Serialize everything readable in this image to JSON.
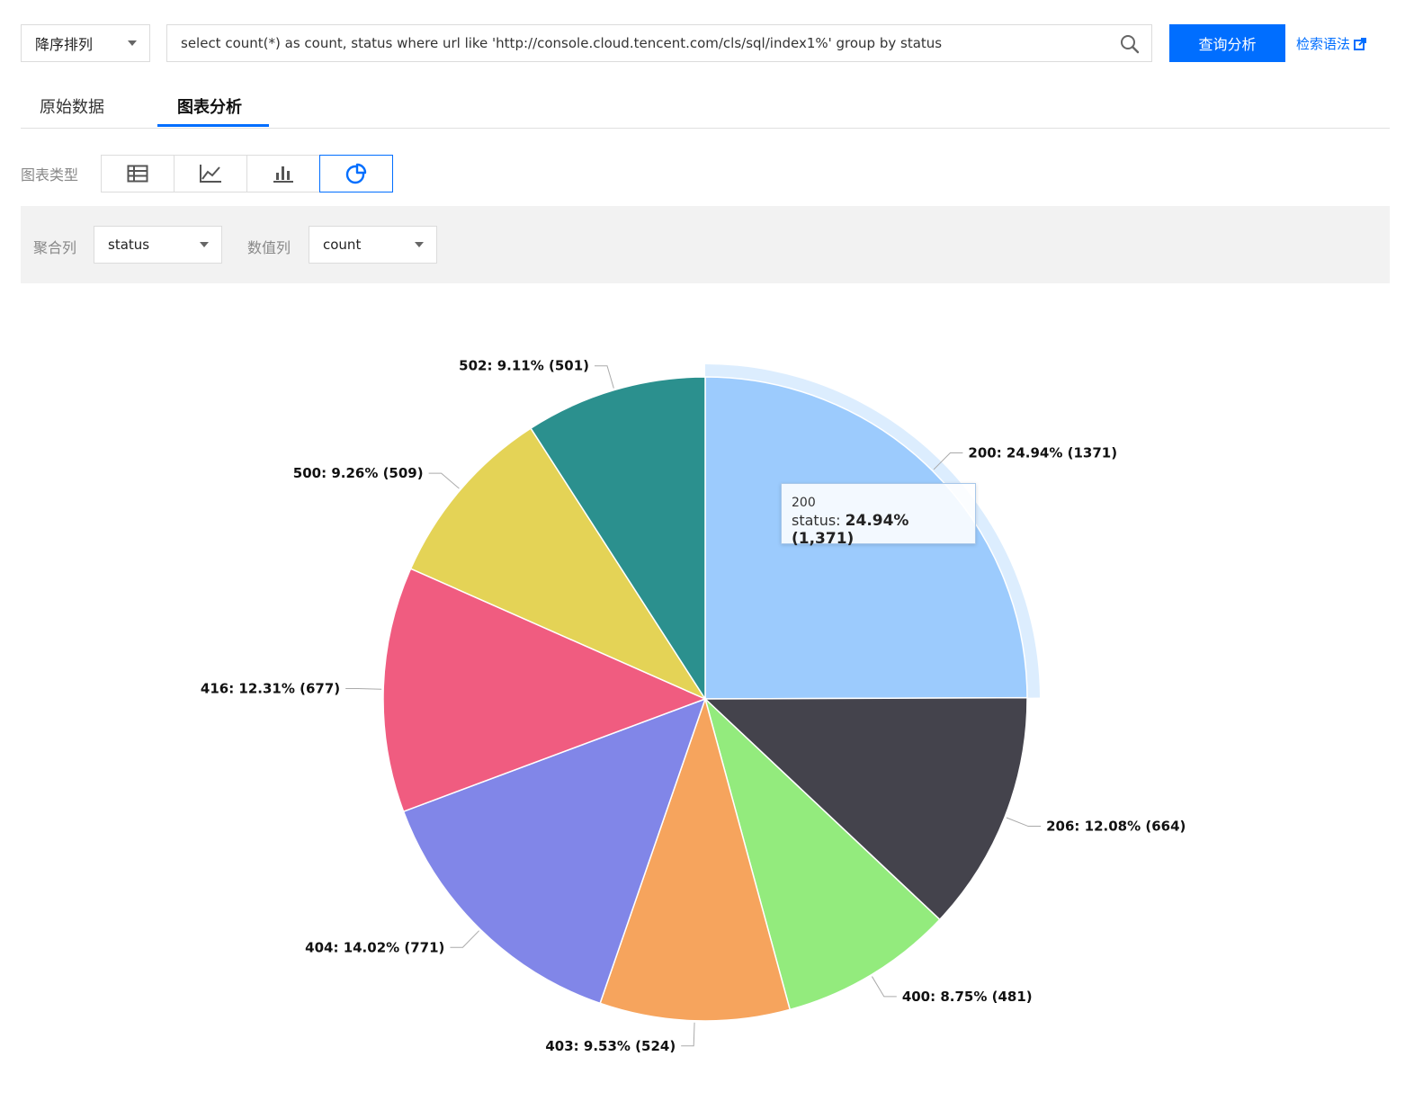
{
  "query_bar": {
    "sort_label": "降序排列",
    "query": "select count(*) as count, status where url like 'http://console.cloud.tencent.com/cls/sql/index1%' group by status",
    "search_button": "查询分析",
    "syntax_link": "检索语法"
  },
  "tabs": [
    {
      "label": "原始数据",
      "active": false
    },
    {
      "label": "图表分析",
      "active": true
    }
  ],
  "chart_type": {
    "label": "图表类型",
    "options": [
      "table-icon",
      "line-chart-icon",
      "bar-chart-icon",
      "pie-chart-icon"
    ],
    "selected": "pie-chart-icon"
  },
  "config": {
    "group_label": "聚合列",
    "group_value": "status",
    "value_label": "数值列",
    "value_value": "count"
  },
  "colors": {
    "accent": "#006eff",
    "panel_bg": "#f2f2f2"
  },
  "chart_data": {
    "type": "pie",
    "categories": [
      "200",
      "206",
      "400",
      "403",
      "404",
      "416",
      "500",
      "502"
    ],
    "values": [
      1371,
      664,
      481,
      524,
      771,
      677,
      509,
      501
    ],
    "percents": [
      "24.94%",
      "12.08%",
      "8.75%",
      "9.53%",
      "14.02%",
      "12.31%",
      "9.26%",
      "9.11%"
    ],
    "labels": [
      "200: 24.94% (1371)",
      "206: 12.08% (664)",
      "400: 8.75% (481)",
      "403: 9.53% (524)",
      "404: 14.02% (771)",
      "416: 12.31% (677)",
      "500: 9.26% (509)",
      "502: 9.11% (501)"
    ],
    "colors": [
      "#9ccbfd",
      "#44434c",
      "#93eb7d",
      "#f6a45d",
      "#8186e8",
      "#f05c80",
      "#e4d356",
      "#2b908e"
    ],
    "highlighted": "200",
    "tooltip": {
      "title": "200",
      "series": "status:",
      "value": "24.94% (1,371)"
    }
  }
}
